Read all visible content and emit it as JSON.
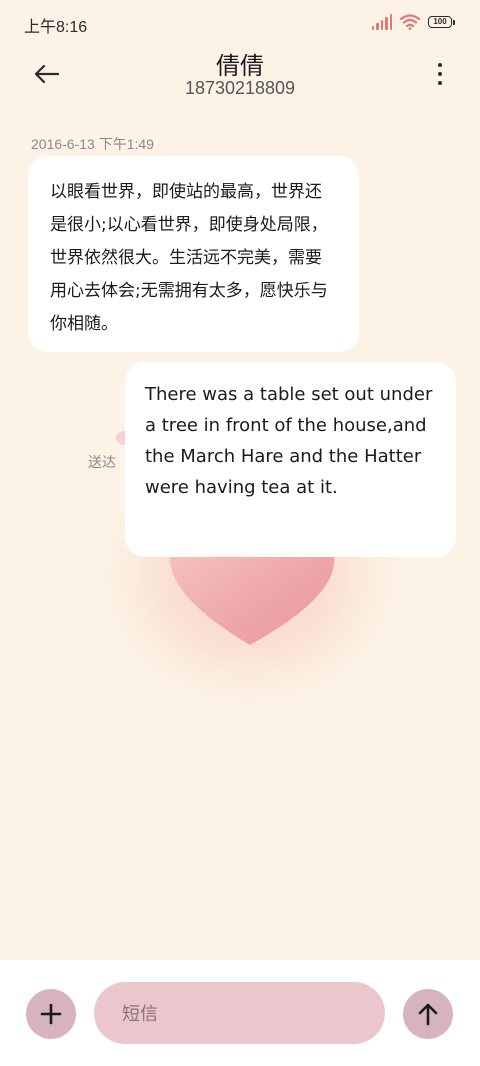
{
  "status_bar": {
    "time": "上午8:16",
    "battery": "100",
    "icons": [
      "signal-icon",
      "wifi-icon",
      "battery-icon"
    ],
    "signal_color": "#e27575"
  },
  "header": {
    "contact_name": "倩倩",
    "contact_number": "18730218809",
    "back_icon": "back-arrow-icon",
    "more_icon": "more-vertical-icon"
  },
  "conversation": {
    "timestamp": "2016-6-13 下午1:49",
    "incoming_message": "以眼看世界，即使站的最高，世界还是很小;以心看世界，即使身处局限，世界依然很大。生活远不完美，需要用心去体会;无需拥有太多，愿快乐与你相随。",
    "outgoing_message": "There was a table set out under a tree in front of the house,and the March Hare and the Hatter were having tea at it.",
    "sent_status": "送达"
  },
  "composer": {
    "attach_icon": "plus-icon",
    "input_placeholder": "短信",
    "send_icon": "arrow-up-icon"
  },
  "colors": {
    "background": "#fcf3e6",
    "bubble": "#ffffff",
    "composer_button": "#d7b4bd",
    "input_background": "#ebc6cc"
  }
}
